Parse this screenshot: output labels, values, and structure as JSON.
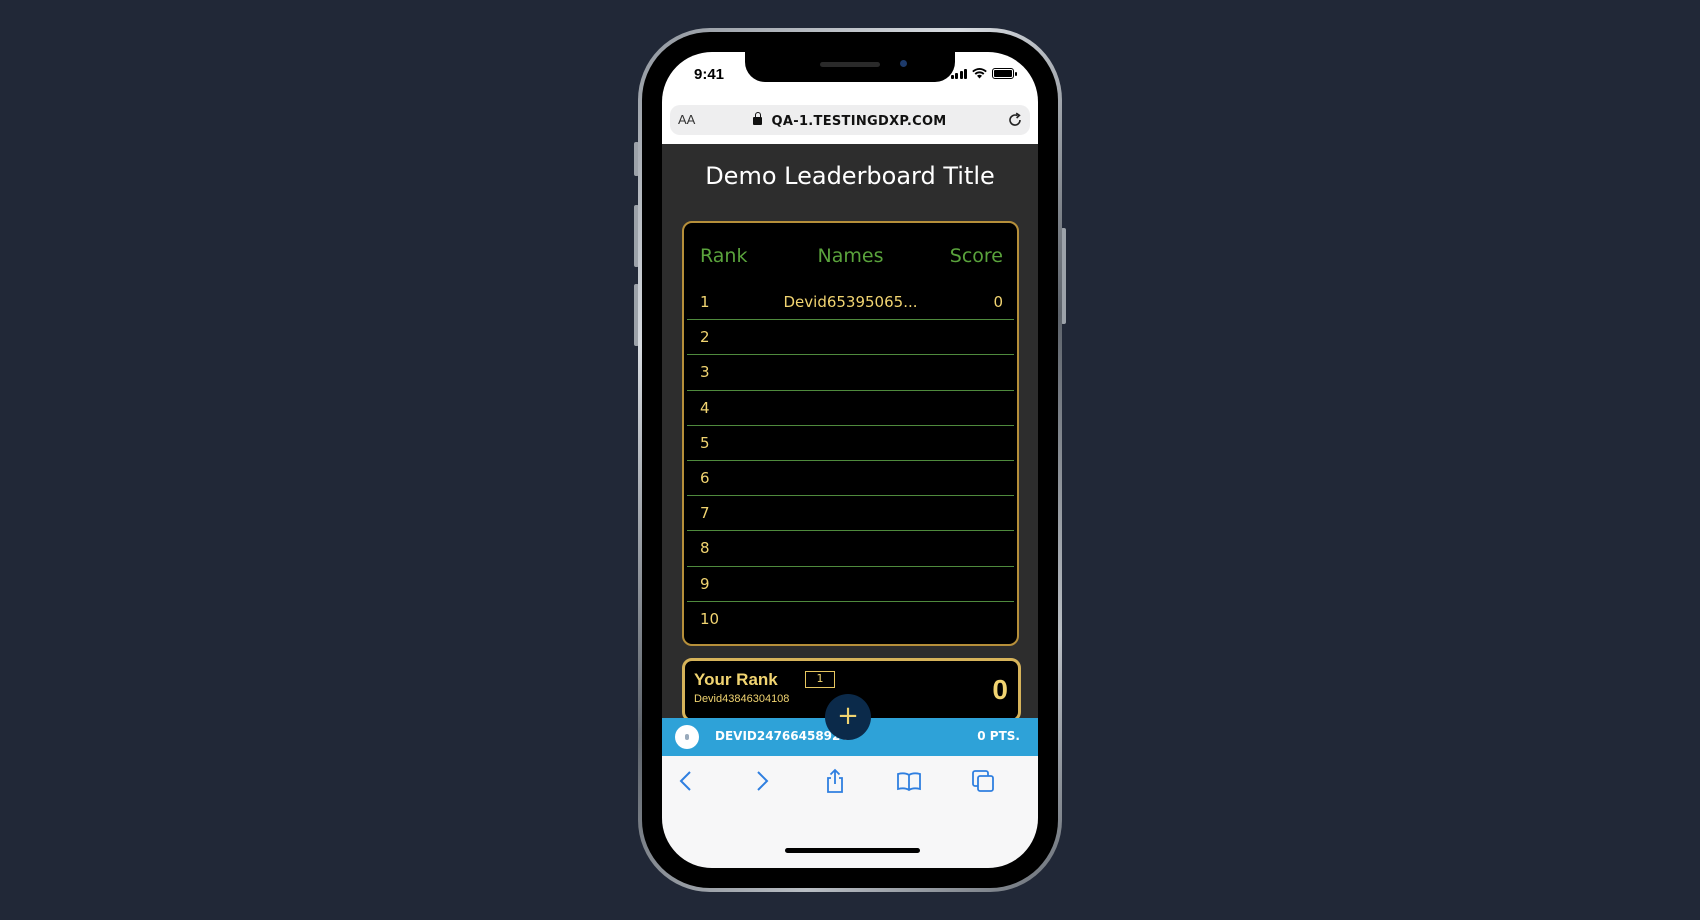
{
  "status_bar": {
    "time": "9:41"
  },
  "browser": {
    "text_size_label": "AA",
    "url": "QA-1.TESTINGDXP.COM"
  },
  "leaderboard": {
    "title": "Demo Leaderboard Title",
    "columns": {
      "rank": "Rank",
      "names": "Names",
      "score": "Score"
    },
    "rows": [
      {
        "rank": "1",
        "name": "Devid65395065...",
        "score": "0"
      },
      {
        "rank": "2",
        "name": "",
        "score": ""
      },
      {
        "rank": "3",
        "name": "",
        "score": ""
      },
      {
        "rank": "4",
        "name": "",
        "score": ""
      },
      {
        "rank": "5",
        "name": "",
        "score": ""
      },
      {
        "rank": "6",
        "name": "",
        "score": ""
      },
      {
        "rank": "7",
        "name": "",
        "score": ""
      },
      {
        "rank": "8",
        "name": "",
        "score": ""
      },
      {
        "rank": "9",
        "name": "",
        "score": ""
      },
      {
        "rank": "10",
        "name": "",
        "score": ""
      }
    ]
  },
  "your_rank": {
    "label": "Your Rank",
    "rank": "1",
    "name": "Devid43846304108",
    "score": "0"
  },
  "player_strip": {
    "name": "DEVID24766458924",
    "points": "0 PTS."
  },
  "fab": {
    "label": "+"
  },
  "toolbar": {
    "icons": [
      "back-icon",
      "forward-icon",
      "share-icon",
      "bookmarks-icon",
      "tabs-icon"
    ]
  },
  "colors": {
    "background": "#212837",
    "accent_gold": "#f1d471",
    "header_green": "#5aa33c",
    "strip_blue": "#2ea2d8",
    "fab_navy": "#0b2a4a"
  }
}
